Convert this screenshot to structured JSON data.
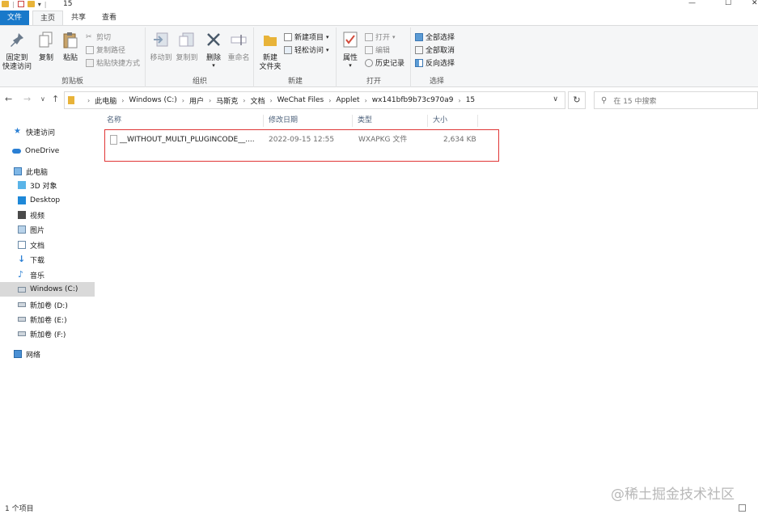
{
  "window": {
    "title": "15",
    "controls": {
      "minimize": "—",
      "maximize": "☐",
      "close": "✕"
    }
  },
  "ribbon_tabs": [
    "文件",
    "主页",
    "共享",
    "查看"
  ],
  "ribbon": {
    "clipboard": {
      "label": "剪贴板",
      "pin_l1": "固定到",
      "pin_l2": "快速访问",
      "copy": "复制",
      "paste": "粘贴",
      "cut": "剪切",
      "copy_path": "复制路径",
      "paste_shortcut": "粘贴快捷方式"
    },
    "organize": {
      "label": "组织",
      "move_to": "移动到",
      "copy_to": "复制到",
      "delete": "删除",
      "rename": "重命名"
    },
    "new": {
      "label": "新建",
      "new_folder_l1": "新建",
      "new_folder_l2": "文件夹",
      "new_item": "新建项目",
      "easy_access": "轻松访问"
    },
    "open": {
      "label": "打开",
      "properties": "属性",
      "open": "打开",
      "edit": "编辑",
      "history": "历史记录"
    },
    "select": {
      "label": "选择",
      "select_all": "全部选择",
      "select_none": "全部取消",
      "invert": "反向选择"
    }
  },
  "address": {
    "crumbs": [
      "此电脑",
      "Windows (C:)",
      "用户",
      "马斯克",
      "文档",
      "WeChat Files",
      "Applet",
      "wx141bfb9b73c970a9",
      "15"
    ],
    "search_placeholder": "在 15 中搜索"
  },
  "nav": {
    "quick_access": "快速访问",
    "onedrive": "OneDrive",
    "this_pc": "此电脑",
    "items": [
      "3D 对象",
      "Desktop",
      "视频",
      "图片",
      "文档",
      "下载",
      "音乐",
      "Windows (C:)",
      "新加卷 (D:)",
      "新加卷 (E:)",
      "新加卷 (F:)"
    ],
    "network": "网络"
  },
  "columns": {
    "name": "名称",
    "modified": "修改日期",
    "type": "类型",
    "size": "大小"
  },
  "files": [
    {
      "name": "__WITHOUT_MULTI_PLUGINCODE__....",
      "modified": "2022-09-15 12:55",
      "type": "WXAPKG 文件",
      "size": "2,634 KB"
    }
  ],
  "status": "1 个项目",
  "watermark": "@稀土掘金技术社区",
  "colors": {
    "file_tab": "#1979ca",
    "highlight": "#e03636",
    "selected_nav": "#d9d9d9",
    "folder": "#e8b339"
  }
}
